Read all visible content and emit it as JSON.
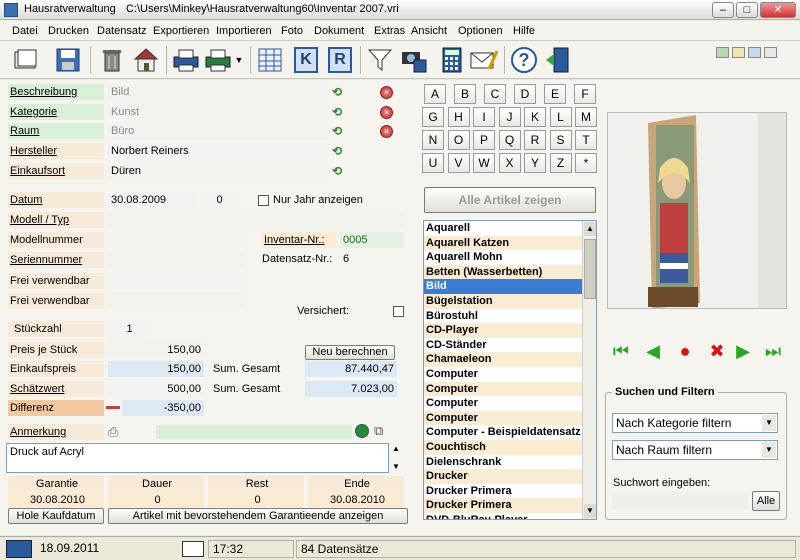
{
  "window": {
    "title": "Hausratverwaltung",
    "path": "C:\\Users\\Minkey\\Hausratverwaltung60\\Inventar 2007.vri",
    "btn_min": "–",
    "btn_max": "□",
    "btn_close": "✕"
  },
  "menu": [
    "Datei",
    "Drucken",
    "Datensatz",
    "Exportieren",
    "Importieren",
    "Foto",
    "Dokument",
    "Extras",
    "Ansicht",
    "Optionen",
    "Hilfe"
  ],
  "toolbar_icons": [
    "open-book-icon",
    "save-disk-icon",
    "trash-icon",
    "house-icon",
    "printer-icon",
    "printer-preview-icon",
    "dropdown-arrow-icon",
    "table-icon",
    "k-icon",
    "r-icon",
    "filter-funnel-icon",
    "camera-save-icon",
    "calculator-icon",
    "email-icon",
    "help-icon",
    "exit-door-icon"
  ],
  "toolbar_text": {
    "k": "K",
    "r": "R",
    "help": "?"
  },
  "colors": {
    "green_label": "#d8f0d8",
    "orange_label": "#faebd2",
    "selected": "#3a7bd5",
    "nav_green": "#22aa22",
    "nav_red": "#dd1111"
  },
  "fields": {
    "beschreibung": {
      "label": "Beschreibung",
      "value": "Bild"
    },
    "kategorie": {
      "label": "Kategorie",
      "value": "Kunst"
    },
    "raum": {
      "label": "Raum",
      "value": "Büro"
    },
    "hersteller": {
      "label": "Hersteller",
      "value": "Norbert Reiners"
    },
    "einkaufsort": {
      "label": "Einkaufsort",
      "value": "Düren"
    },
    "datum": {
      "label": "Datum",
      "value": "30.08.2009",
      "extra": "0"
    },
    "nur_jahr": "Nur Jahr anzeigen",
    "modell": {
      "label": "Modell / Typ",
      "value": ""
    },
    "modellnummer": {
      "label": "Modellnummer",
      "value": ""
    },
    "seriennummer": {
      "label": "Seriennummer",
      "value": ""
    },
    "frei1": {
      "label": "Frei verwendbar",
      "value": ""
    },
    "frei2": {
      "label": "Frei verwendbar",
      "value": ""
    },
    "inventar_nr": {
      "label": "Inventar-Nr.:",
      "value": "0005"
    },
    "datensatz_nr": {
      "label": "Datensatz-Nr.:",
      "value": "6"
    },
    "versichert": "Versichert:",
    "stueckzahl": {
      "label": "Stückzahl",
      "value": "1"
    },
    "preis": {
      "label": "Preis je Stück",
      "value": "150,00"
    },
    "einkaufspreis": {
      "label": "Einkaufspreis",
      "value": "150,00"
    },
    "schaetzwert": {
      "label": "Schätzwert",
      "value": "500,00"
    },
    "differenz": {
      "label": "Differenz",
      "value": "-350,00"
    },
    "sum1": {
      "label": "Sum. Gesamt",
      "value": "87.440,47"
    },
    "sum2": {
      "label": "Sum. Gesamt",
      "value": "7.023,00"
    },
    "neu_berechnen": "Neu berechnen",
    "anmerkung": {
      "label": "Anmerkung",
      "value": "Druck auf Acryl"
    }
  },
  "garantie": {
    "headers": [
      "Garantie",
      "Dauer",
      "Rest",
      "Ende"
    ],
    "values": [
      "30.08.2010",
      "0",
      "0",
      "30.08.2010"
    ],
    "hole_btn": "Hole Kaufdatum",
    "artikel_btn": "Artikel mit bevorstehendem Garantieende anzeigen"
  },
  "letters": [
    "A",
    "B",
    "C",
    "D",
    "E",
    "F",
    "G",
    "H",
    "I",
    "J",
    "K",
    "L",
    "M",
    "N",
    "O",
    "P",
    "Q",
    "R",
    "S",
    "T",
    "U",
    "V",
    "W",
    "X",
    "Y",
    "Z",
    "*"
  ],
  "alle_artikel": "Alle Artikel zeigen",
  "articles": [
    "Aquarell",
    "Aquarell Katzen",
    "Aquarell Mohn",
    "Betten (Wasserbetten)",
    "Bild",
    "Bügelstation",
    "Bürostuhl",
    "CD-Player",
    "CD-Ständer",
    "Chamaeleon",
    "Computer",
    "Computer",
    "Computer",
    "Computer",
    "Computer - Beispieldatensatz",
    "Couchtisch",
    "Dielenschrank",
    "Drucker",
    "Drucker Primera",
    "Drucker Primera",
    "DVD-BluRay-Player"
  ],
  "selected_article_index": 4,
  "nav_icons": [
    "first-record-icon",
    "prev-record-icon",
    "record-icon",
    "delete-record-icon",
    "next-record-icon",
    "last-record-icon"
  ],
  "nav_glyphs": [
    "⏮",
    "◀",
    "●",
    "✖",
    "▶",
    "⏭"
  ],
  "search": {
    "title": "Suchen und Filtern",
    "kategorie_filter": "Nach Kategorie filtern",
    "raum_filter": "Nach Raum filtern",
    "suchwort_label": "Suchwort eingeben:",
    "suchwort_value": "",
    "alle": "Alle"
  },
  "status": {
    "date": "18.09.2011",
    "time": "17:32",
    "count": "84 Datensätze"
  }
}
